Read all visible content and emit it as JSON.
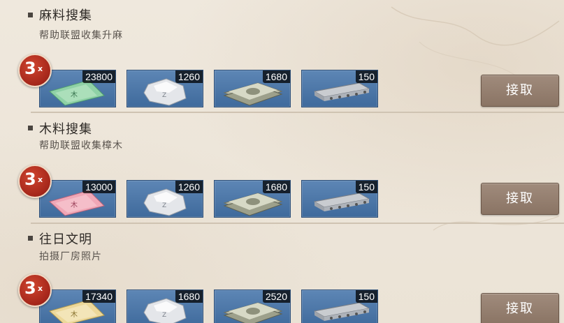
{
  "tasks": [
    {
      "title": "麻料搜集",
      "desc": "帮助联盟收集升麻",
      "multiplier": "3",
      "multiplier_suffix": "x",
      "claim_label": "接取",
      "rewards": [
        {
          "item": "material-card-green",
          "count": "23800"
        },
        {
          "item": "silver-ore",
          "count": "1260"
        },
        {
          "item": "cash-bundle",
          "count": "1680"
        },
        {
          "item": "concrete-slab",
          "count": "150"
        }
      ]
    },
    {
      "title": "木料搜集",
      "desc": "帮助联盟收集樟木",
      "multiplier": "3",
      "multiplier_suffix": "x",
      "claim_label": "接取",
      "rewards": [
        {
          "item": "material-card-pink",
          "count": "13000"
        },
        {
          "item": "silver-ore",
          "count": "1260"
        },
        {
          "item": "cash-bundle",
          "count": "1680"
        },
        {
          "item": "concrete-slab",
          "count": "150"
        }
      ]
    },
    {
      "title": "往日文明",
      "desc": "拍摄厂房照片",
      "multiplier": "3",
      "multiplier_suffix": "x",
      "claim_label": "接取",
      "rewards": [
        {
          "item": "material-card-gold",
          "count": "17340"
        },
        {
          "item": "silver-ore",
          "count": "1680"
        },
        {
          "item": "cash-bundle",
          "count": "2520"
        },
        {
          "item": "concrete-slab",
          "count": "150"
        }
      ]
    }
  ]
}
